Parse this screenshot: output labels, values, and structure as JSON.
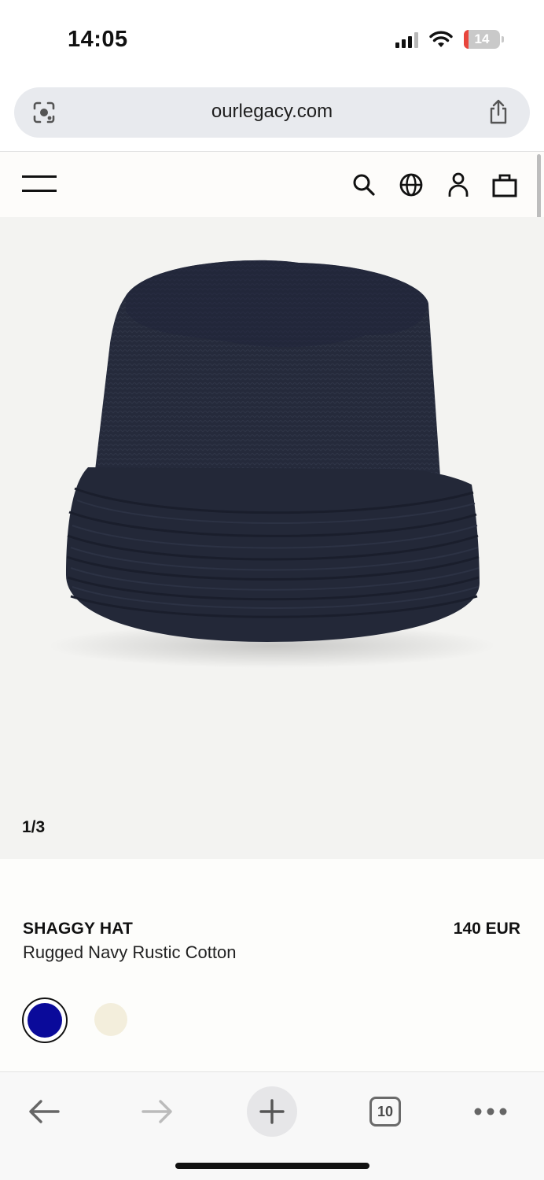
{
  "status_bar": {
    "time": "14:05",
    "battery_level": "14",
    "icons": [
      "signal-icon",
      "wifi-icon",
      "battery-icon"
    ]
  },
  "browser": {
    "url": "ourlegacy.com",
    "left_icon": "visual-search-icon",
    "right_icon": "share-icon",
    "toolbar": {
      "tab_count": "10",
      "icons": [
        "back-arrow-icon",
        "forward-arrow-icon",
        "plus-icon",
        "tabs-icon",
        "more-icon"
      ]
    }
  },
  "site_header": {
    "icons": [
      "menu-icon",
      "search-icon",
      "globe-icon",
      "account-icon",
      "bag-icon"
    ]
  },
  "product": {
    "image_counter": "1/3",
    "name": "SHAGGY HAT",
    "color_name": "Rugged Navy Rustic Cotton",
    "price": "140 EUR",
    "swatches": [
      {
        "color": "#0a0a9a",
        "selected": true
      },
      {
        "color": "#f3eedc",
        "selected": false
      }
    ]
  },
  "colors": {
    "hat_navy": "#23283a",
    "image_background": "#f3f3f1"
  }
}
